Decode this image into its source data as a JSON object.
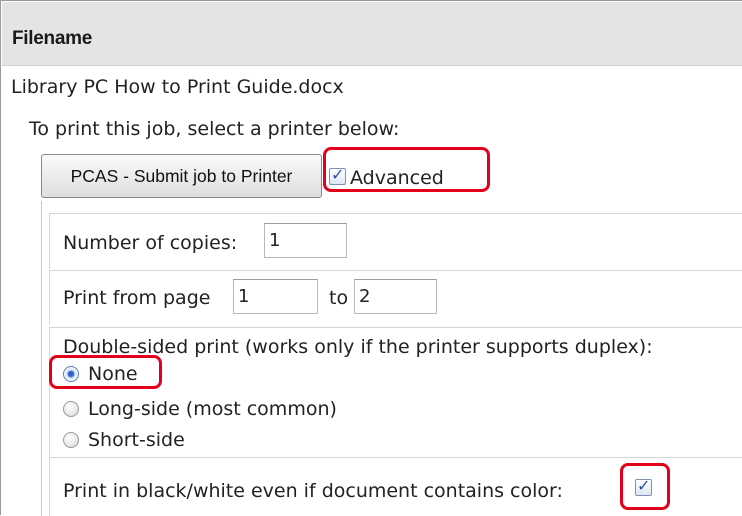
{
  "header": {
    "title": "Filename"
  },
  "file": {
    "name": "Library PC How to Print Guide.docx"
  },
  "instruction": "To print this job, select a printer below:",
  "printer_button": {
    "label": "PCAS - Submit job to Printer"
  },
  "advanced": {
    "label": "Advanced",
    "checked": true
  },
  "copies": {
    "label": "Number of copies:",
    "value": "1"
  },
  "page_range": {
    "label": "Print from page",
    "from_value": "1",
    "to_label": "to",
    "to_value": "2"
  },
  "duplex": {
    "label": "Double-sided print (works only if the printer supports duplex):",
    "options": [
      {
        "label": "None",
        "checked": true
      },
      {
        "label": "Long-side (most common)",
        "checked": false
      },
      {
        "label": "Short-side",
        "checked": false
      }
    ]
  },
  "grayscale": {
    "label": "Print in black/white even if document contains color:",
    "checked": true
  },
  "colors": {
    "highlight": "#e3001b",
    "header_bg": "#e4e4e4",
    "check_mark": "#2b4fa8"
  }
}
